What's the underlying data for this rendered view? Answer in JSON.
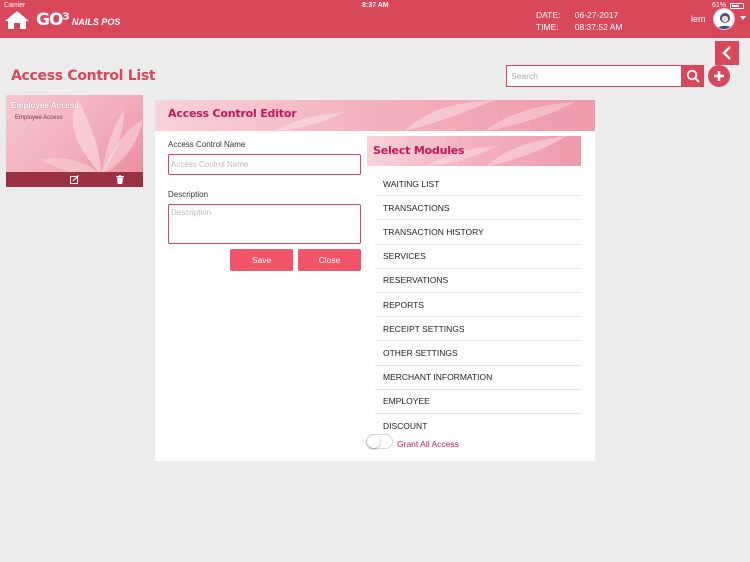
{
  "status_bar": {
    "carrier": "Carrier",
    "time": "8:37 AM",
    "battery": "61%"
  },
  "header": {
    "logo_text": "GO³",
    "logo_sub": "NAILS POS",
    "date_label": "DATE:",
    "date_value": "06-27-2017",
    "time_label": "TIME:",
    "time_value": "08:37:52 AM",
    "user": "lem"
  },
  "page": {
    "title": "Access Control List"
  },
  "search": {
    "placeholder": "Search",
    "value": ""
  },
  "acl_list": [
    {
      "title": "Employee Access",
      "subtitle": "Employee Access"
    }
  ],
  "editor": {
    "title": "Access Control Editor",
    "name_label": "Access Control Name",
    "name_placeholder": "Access Control Name",
    "name_value": "",
    "description_label": "Description",
    "description_placeholder": "Description",
    "description_value": "",
    "save_label": "Save",
    "close_label": "Close"
  },
  "modules": {
    "title": "Select Modules",
    "items": [
      "WAITING LIST",
      "TRANSACTIONS",
      "TRANSACTION HISTORY",
      "SERVICES",
      "RESERVATIONS",
      "REPORTS",
      "RECEIPT SETTINGS",
      "OTHER SETTINGS",
      "MERCHANT INFORMATION",
      "EMPLOYEE",
      "DISCOUNT"
    ],
    "grant_all_label": "Grant All Access",
    "grant_all_enabled": false
  },
  "colors": {
    "accent": "#d9475a",
    "button": "#f25468",
    "magenta": "#c2185b"
  },
  "icons": [
    "home-icon",
    "back-icon",
    "search-icon",
    "plus-icon",
    "edit-icon",
    "trash-icon",
    "avatar-icon"
  ]
}
